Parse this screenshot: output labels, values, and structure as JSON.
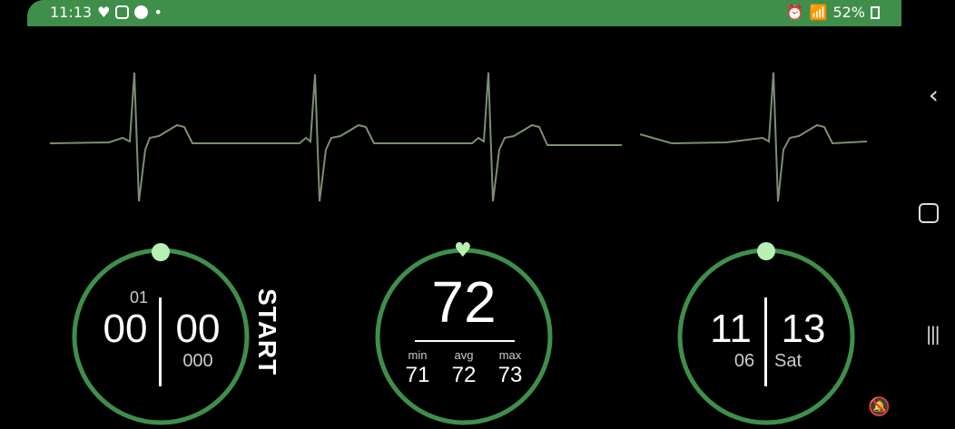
{
  "status": {
    "time": "11:13",
    "battery": "52%"
  },
  "stopwatch": {
    "hours": "01",
    "minutes": "00",
    "seconds": "00",
    "millis": "000",
    "action": "START"
  },
  "heart": {
    "bpm": "72",
    "min_label": "min",
    "avg_label": "avg",
    "max_label": "max",
    "min": "71",
    "avg": "72",
    "max": "73"
  },
  "clock": {
    "hours": "11",
    "minutes": "13",
    "date": "06",
    "day": "Sat"
  },
  "colors": {
    "accent": "#3f8f4a",
    "icon": "#b7f0b2",
    "ecg": "#7b8f71"
  }
}
